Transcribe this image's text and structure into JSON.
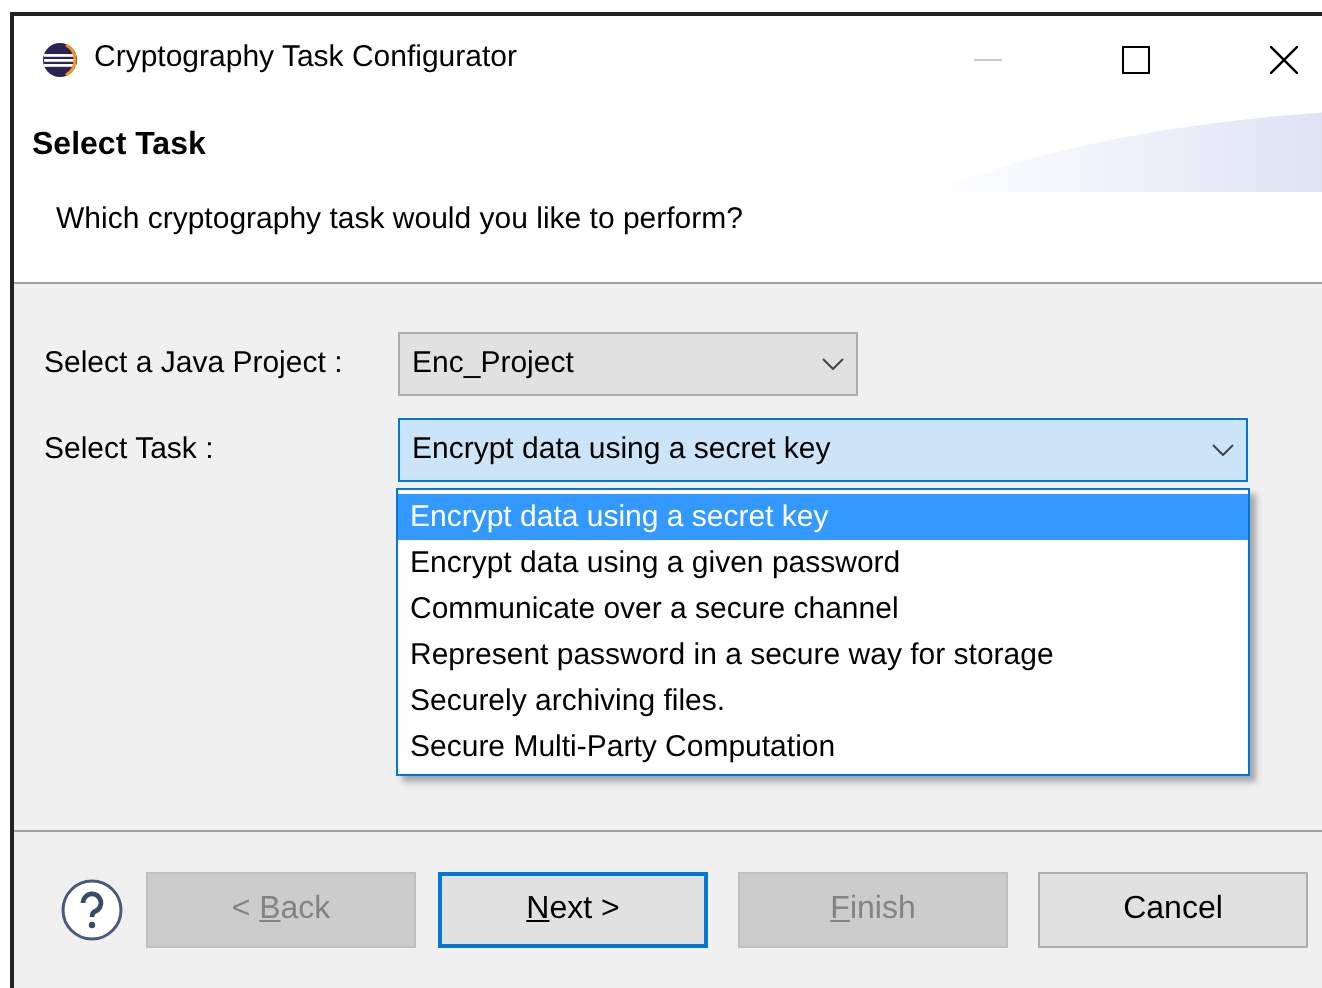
{
  "window": {
    "title": "Cryptography Task Configurator"
  },
  "header": {
    "title": "Select Task",
    "description": "Which cryptography task would you like to perform?"
  },
  "fields": [
    {
      "label": "Select a Java Project :",
      "value": "Enc_Project",
      "focused": false
    },
    {
      "label": "Select Task :",
      "value": "Encrypt data using a secret key",
      "focused": true
    }
  ],
  "dropdown": {
    "options": [
      {
        "label": "Encrypt data using a secret key",
        "selected": true
      },
      {
        "label": "Encrypt data using a given password",
        "selected": false
      },
      {
        "label": "Communicate over a secure channel",
        "selected": false
      },
      {
        "label": "Represent password in a secure way for storage",
        "selected": false
      },
      {
        "label": "Securely archiving files.",
        "selected": false
      },
      {
        "label": "Secure Multi-Party Computation",
        "selected": false
      }
    ]
  },
  "buttons": [
    {
      "label_parts": [
        {
          "text": "< ",
          "underlined": false
        },
        {
          "text": "B",
          "underlined": true
        },
        {
          "text": "ack",
          "underlined": false
        }
      ],
      "disabled": true,
      "default": false
    },
    {
      "label_parts": [
        {
          "text": "N",
          "underlined": true
        },
        {
          "text": "ext >",
          "underlined": false
        }
      ],
      "disabled": false,
      "default": true
    },
    {
      "label_parts": [
        {
          "text": "F",
          "underlined": true
        },
        {
          "text": "inish",
          "underlined": false
        }
      ],
      "disabled": true,
      "default": false
    },
    {
      "label_parts": [
        {
          "text": "Cancel",
          "underlined": false
        }
      ],
      "disabled": false,
      "default": false
    }
  ]
}
